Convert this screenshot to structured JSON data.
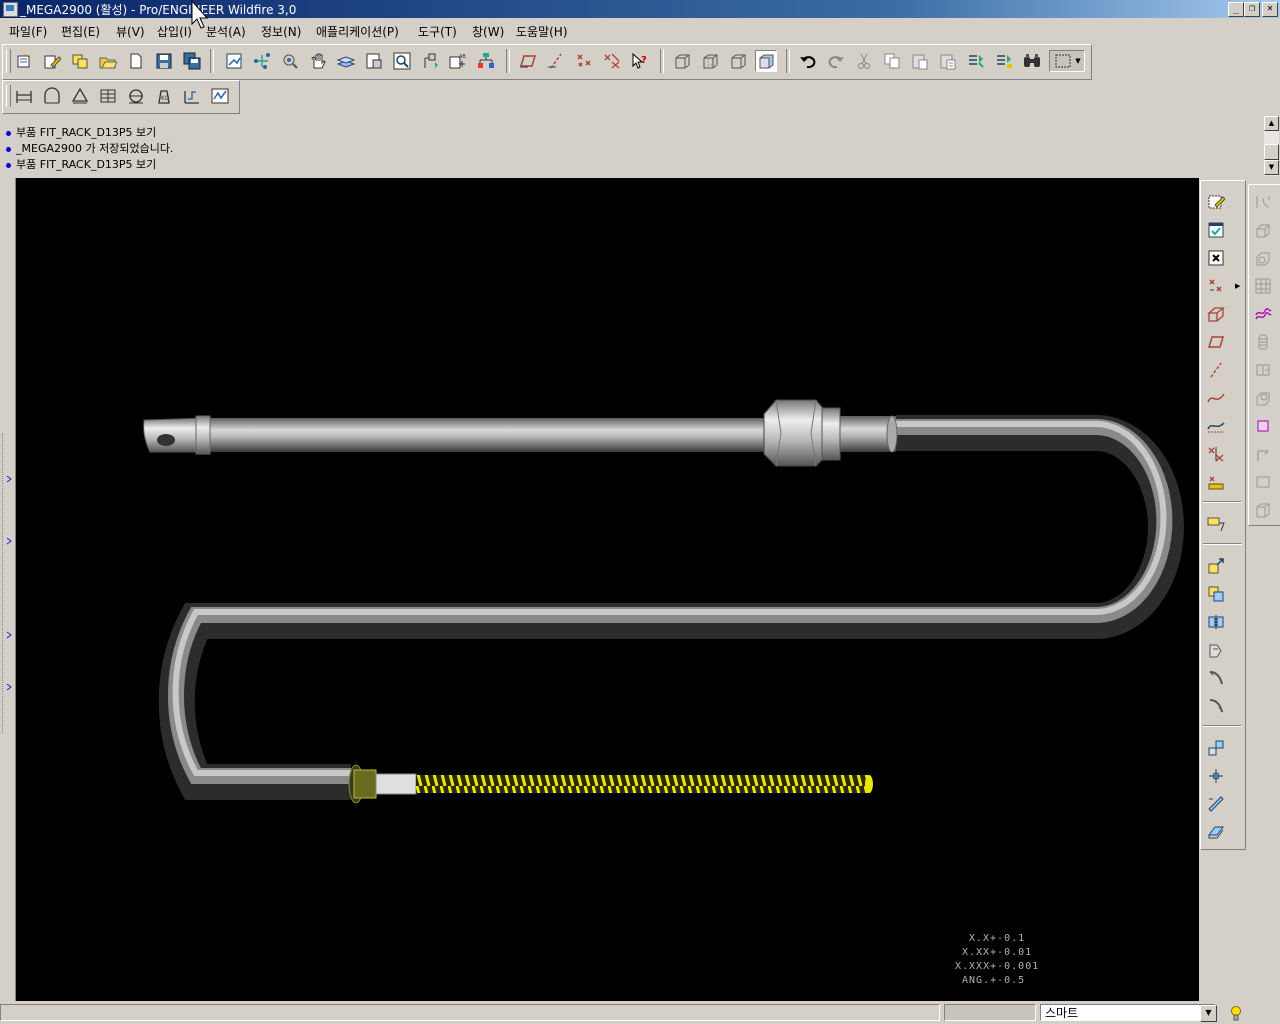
{
  "window": {
    "title": "_MEGA2900 (활성) - Pro/ENGINEER Wildfire 3,0",
    "buttons": {
      "minimize": "_",
      "restore": "❐",
      "close": "✕"
    }
  },
  "menu": {
    "items": [
      {
        "label": "파일(F)"
      },
      {
        "label": "편집(E)"
      },
      {
        "label": "뷰(V)"
      },
      {
        "label": "삽입(I)"
      },
      {
        "label": "분석(A)"
      },
      {
        "label": "정보(N)"
      },
      {
        "label": "애플리케이션(P)"
      },
      {
        "label": "도구(T)"
      },
      {
        "label": "창(W)"
      },
      {
        "label": "도움말(H)"
      }
    ]
  },
  "messages": [
    {
      "text": "부품 FIT_RACK_D13P5 보기"
    },
    {
      "text": "_MEGA2900 가 저장되었습니다."
    },
    {
      "text": "부품 FIT_RACK_D13P5 보기"
    }
  ],
  "tolerance_table": [
    {
      "text": "X.X+-0.1"
    },
    {
      "text": "X.XX+-0.01"
    },
    {
      "text": "X.XXX+-0.001"
    },
    {
      "text": "ANG.+-0.5"
    }
  ],
  "status": {
    "filter_value": "스마트"
  },
  "icons": {
    "toolbar_top": [
      "new-icon",
      "edit-icon",
      "layer-icon",
      "open-icon",
      "page-icon",
      "save-icon",
      "save-copy-icon",
      "repaint-icon",
      "spin-center-icon",
      "orient-icon",
      "pan-icon",
      "layers-icon",
      "view-manager-icon",
      "zoom-window-icon",
      "model-tree-icon",
      "saved-views-icon",
      "appearance-icon",
      "datum-plane-icon",
      "datum-axis-icon",
      "datum-point-icon",
      "csys-icon",
      "whats-this-icon",
      "wireframe-icon",
      "hidden-line-icon",
      "no-hidden-icon",
      "shading-icon",
      "undo-icon",
      "redo-icon",
      "cut-icon",
      "copy-icon",
      "paste-icon",
      "paste-special-icon",
      "regenerate-icon",
      "regen-manager-icon",
      "find-icon",
      "select-box-icon"
    ],
    "toolbar_second": [
      "measure-distance-icon",
      "measure-angle-icon",
      "measure-area-icon",
      "measure-table-icon",
      "section-icon",
      "mass-props-icon",
      "analysis-icon",
      "graph-icon"
    ]
  }
}
